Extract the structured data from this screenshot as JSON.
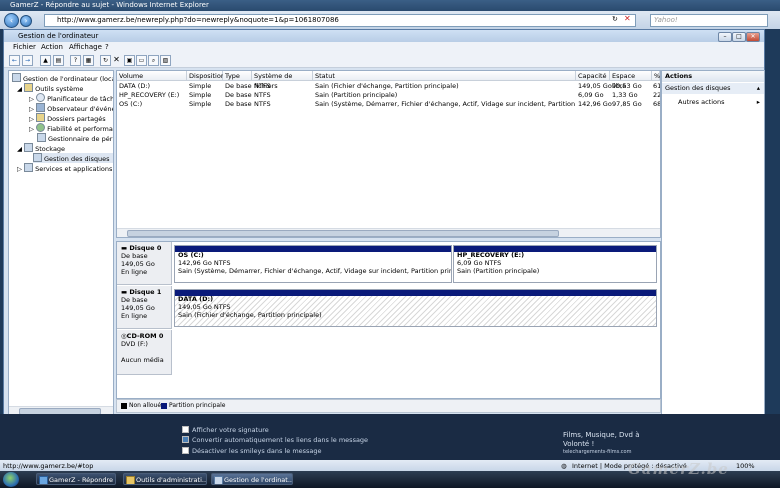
{
  "ie": {
    "title": "GamerZ - Répondre au sujet - Windows Internet Explorer",
    "url": "http://www.gamerz.be/newreply.php?do=newreply&noquote=1&p=1061807086",
    "search_placeholder": "Yahoo!",
    "status_url": "http://www.gamerz.be/#top",
    "status_zone": "Internet | Mode protégé : désactivé",
    "zoom": "100%"
  },
  "mmc": {
    "title": "Gestion de l'ordinateur",
    "menu": [
      "Fichier",
      "Action",
      "Affichage",
      "?"
    ],
    "tree": [
      {
        "label": "Gestion de l'ordinateur (local)",
        "level": 0
      },
      {
        "label": "Outils système",
        "level": 1
      },
      {
        "label": "Planificateur de tâches",
        "level": 2
      },
      {
        "label": "Observateur d'événements",
        "level": 2
      },
      {
        "label": "Dossiers partagés",
        "level": 2
      },
      {
        "label": "Fiabilité et performances",
        "level": 2
      },
      {
        "label": "Gestionnaire de périphériques",
        "level": 2
      },
      {
        "label": "Stockage",
        "level": 1
      },
      {
        "label": "Gestion des disques",
        "level": 2
      },
      {
        "label": "Services et applications",
        "level": 1
      }
    ],
    "columns": [
      "Volume",
      "Disposition",
      "Type",
      "Système de fichiers",
      "Statut",
      "Capacité",
      "Espace libre",
      "%"
    ],
    "volumes": [
      {
        "volume": "DATA (D:)",
        "disposition": "Simple",
        "type": "De base",
        "fs": "NTFS",
        "status": "Sain (Fichier d'échange, Partition principale)",
        "capacity": "149,05 Go",
        "free": "90,53 Go",
        "pct": "61"
      },
      {
        "volume": "HP_RECOVERY (E:)",
        "disposition": "Simple",
        "type": "De base",
        "fs": "NTFS",
        "status": "Sain (Partition principale)",
        "capacity": "6,09 Go",
        "free": "1,33 Go",
        "pct": "22"
      },
      {
        "volume": "OS (C:)",
        "disposition": "Simple",
        "type": "De base",
        "fs": "NTFS",
        "status": "Sain (Système, Démarrer, Fichier d'échange, Actif, Vidage sur incident, Partition principale)",
        "capacity": "142,96 Go",
        "free": "97,85 Go",
        "pct": "68"
      }
    ],
    "disks": [
      {
        "name": "Disque 0",
        "type": "De base",
        "size": "149,05 Go",
        "state": "En ligne",
        "partitions": [
          {
            "name": "OS (C:)",
            "line2": "142,96 Go NTFS",
            "line3": "Sain (Système, Démarrer, Fichier d'échange, Actif, Vidage sur incident, Partition principale)"
          },
          {
            "name": "HP_RECOVERY (E:)",
            "line2": "6,09 Go NTFS",
            "line3": "Sain (Partition principale)"
          }
        ]
      },
      {
        "name": "Disque 1",
        "type": "De base",
        "size": "149,05 Go",
        "state": "En ligne",
        "partitions": [
          {
            "name": "DATA (D:)",
            "line2": "149,05 Go NTFS",
            "line3": "Sain (Fichier d'échange, Partition principale)"
          }
        ]
      },
      {
        "name": "CD-ROM 0",
        "type": "DVD (F:)",
        "size": "",
        "state": "Aucun média",
        "partitions": []
      }
    ],
    "legend": [
      "Non alloué",
      "Partition principale"
    ],
    "actions": {
      "header": "Actions",
      "section": "Gestion des disques",
      "items": [
        "Autres actions"
      ]
    }
  },
  "page": {
    "option1": "Afficher votre signature",
    "option2": "Convertir automatiquement les liens dans le message",
    "option3": "Désactiver les smileys dans le message",
    "ad_line1": "Films, Musique, Dvd à",
    "ad_line2": "Volonté !",
    "ad_site": "telechargements-films.com"
  },
  "taskbar": [
    {
      "label": "GamerZ - Répondre ..."
    },
    {
      "label": "Outils d'administrati..."
    },
    {
      "label": "Gestion de l'ordinat..."
    }
  ],
  "watermark": "GamerZ.be",
  "colors": {
    "primary_partition": "#0a1a7a",
    "unallocated": "#000000"
  }
}
